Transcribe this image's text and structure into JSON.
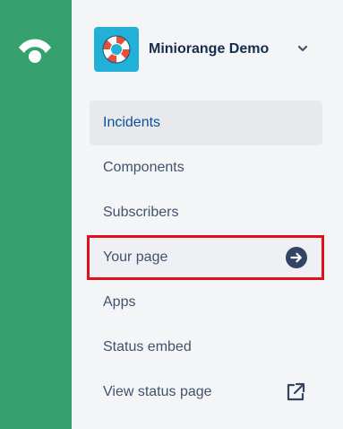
{
  "rail": {
    "logo_icon": "statuspage-logo-icon"
  },
  "page_switcher": {
    "name": "Miniorange Demo",
    "avatar_icon": "lifebuoy-icon",
    "dropdown_icon": "chevron-down-icon"
  },
  "nav": {
    "items": [
      {
        "label": "Incidents",
        "state": "active"
      },
      {
        "label": "Components"
      },
      {
        "label": "Subscribers"
      },
      {
        "label": "Your page",
        "state": "highlighted",
        "icon": "arrow-right-circle-icon"
      },
      {
        "label": "Apps"
      },
      {
        "label": "Status embed"
      },
      {
        "label": "View status page",
        "icon": "external-link-icon"
      }
    ]
  },
  "colors": {
    "rail_green": "#36a16e",
    "highlight_red": "#e0111a",
    "active_blue": "#0c4f9c"
  }
}
